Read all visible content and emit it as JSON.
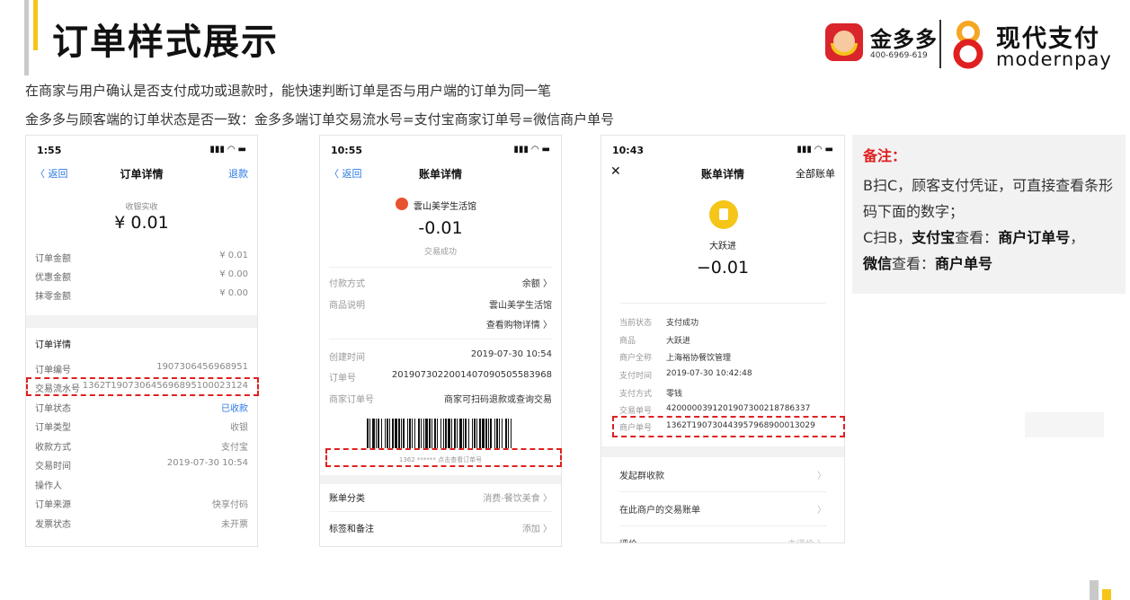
{
  "header": {
    "title": "订单样式展示",
    "logo_jdd_name": "金多多",
    "logo_jdd_phone": "400-6969-619",
    "logo_mp_name": "现代支付",
    "logo_mp_sub": "modernpay"
  },
  "description": {
    "line1": "在商家与用户确认是否支付成功或退款时，能快速判断订单是否与用户端的订单为同一笔",
    "line2": "金多多与顾客端的订单状态是否一致：金多多端订单交易流水号=支付宝商家订单号=微信商户单号"
  },
  "phone1": {
    "time": "1:55",
    "back": "〈 返回",
    "title": "订单详情",
    "action": "退款",
    "paid_label": "收银实收",
    "paid_amount": "¥ 0.01",
    "amounts": [
      {
        "k": "订单金额",
        "v": "¥ 0.01"
      },
      {
        "k": "优惠金额",
        "v": "¥ 0.00"
      },
      {
        "k": "抹零金额",
        "v": "¥ 0.00"
      }
    ],
    "section": "订单详情",
    "details": [
      {
        "k": "订单编号",
        "v": "1907306456968951"
      },
      {
        "k": "交易流水号",
        "v": "1362T1907306456968951000231​24"
      },
      {
        "k": "订单状态",
        "v": "已收款"
      },
      {
        "k": "订单类型",
        "v": "收银"
      },
      {
        "k": "收款方式",
        "v": "支付宝"
      },
      {
        "k": "交易时间",
        "v": "2019-07-30 10:54"
      },
      {
        "k": "操作人",
        "v": ""
      },
      {
        "k": "订单来源",
        "v": "快享付码"
      },
      {
        "k": "发票状态",
        "v": "未开票"
      }
    ]
  },
  "phone2": {
    "time": "10:55",
    "back": "〈 返回",
    "title": "账单详情",
    "merchant": "雲山美学生活馆",
    "amount": "-0.01",
    "status": "交易成功",
    "rows1": [
      {
        "k": "付款方式",
        "v": "余额 〉"
      },
      {
        "k": "商品说明",
        "v": "雲山美学生活馆"
      },
      {
        "k": "",
        "v": "查看购物详情 〉"
      }
    ],
    "rows2": [
      {
        "k": "创建时间",
        "v": "2019-07-30 10:54"
      },
      {
        "k": "订单号",
        "v": "20190730220014070905055839​68"
      },
      {
        "k": "商家订单号",
        "v": "商家可扫码退款或查询交易"
      }
    ],
    "barcode_caption": "1362 ****** 点击查看订单号",
    "rows3": [
      {
        "k": "账单分类",
        "v": "消费-餐饮美食 〉"
      },
      {
        "k": "标签和备注",
        "v": "添加 〉"
      }
    ]
  },
  "phone3": {
    "time": "10:43",
    "close": "✕",
    "title": "账单详情",
    "action": "全部账单",
    "merchant": "大跃进",
    "amount": "−0.01",
    "rows": [
      {
        "k": "当前状态",
        "v": "支付成功"
      },
      {
        "k": "商品",
        "v": "大跃进"
      },
      {
        "k": "商户全称",
        "v": "上海裕协餐饮管理"
      },
      {
        "k": "支付时间",
        "v": "2019-07-30 10:42:48"
      },
      {
        "k": "支付方式",
        "v": "零钱"
      },
      {
        "k": "交易单号",
        "v": "4200000391201907300218786337"
      },
      {
        "k": "商户单号",
        "v": "1362T1907304439579689000130​29"
      }
    ],
    "links": [
      {
        "k": "发起群收款",
        "v": "〉"
      },
      {
        "k": "在此商户的交易账单",
        "v": "〉"
      },
      {
        "k": "评价",
        "v": "未评价 〉"
      }
    ]
  },
  "note": {
    "title": "备注：",
    "line1": "B扫C，顾客支付凭证，可直接查看条形码下面的数字；",
    "line2_a": "C扫B，",
    "line2_b": "支付宝",
    "line2_c": "查看：",
    "line2_d": "商户订单号",
    "line2_e": "，",
    "line3_a": "微信",
    "line3_b": "查看：",
    "line3_c": "商户单号"
  },
  "colors": {
    "accent_yellow": "#f5c518",
    "highlight_red": "#e02020",
    "link_blue": "#2a7ae2"
  }
}
